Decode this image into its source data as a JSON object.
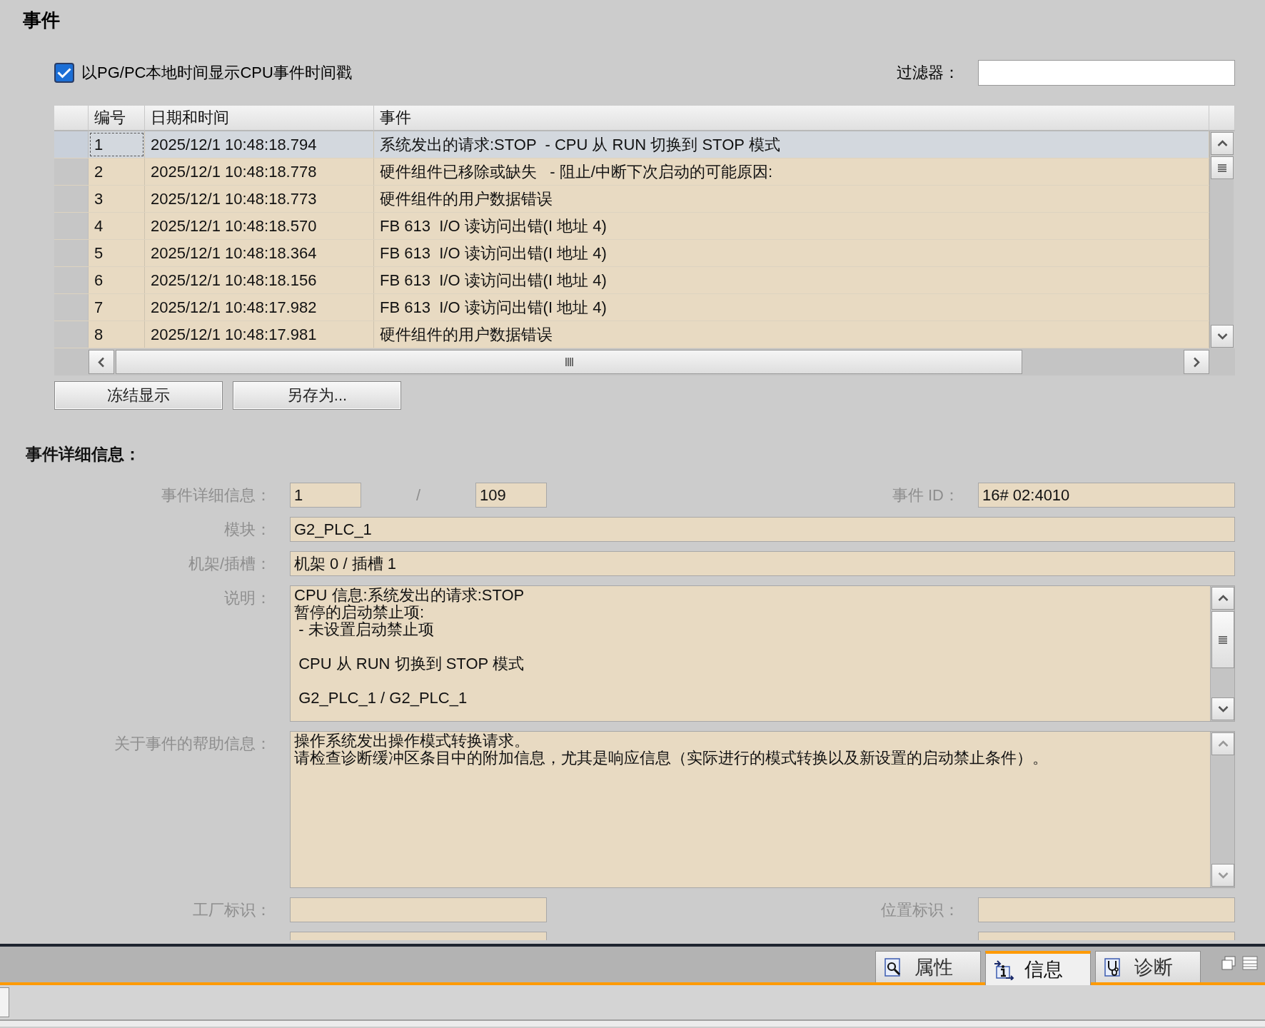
{
  "title": "事件",
  "timestamp_option": {
    "label": "以PG/PC本地时间显示CPU事件时间戳",
    "checked": true
  },
  "filter": {
    "label": "过滤器："
  },
  "table": {
    "columns": [
      "编号",
      "日期和时间",
      "事件"
    ],
    "rows": [
      {
        "number": "1",
        "datetime": "2025/12/1 10:48:18.794",
        "event": "系统发出的请求:STOP  - CPU 从 RUN 切换到 STOP 模式",
        "selected": true
      },
      {
        "number": "2",
        "datetime": "2025/12/1 10:48:18.778",
        "event": "硬件组件已移除或缺失   - 阻止/中断下次启动的可能原因:",
        "selected": false
      },
      {
        "number": "3",
        "datetime": "2025/12/1 10:48:18.773",
        "event": "硬件组件的用户数据错误",
        "selected": false
      },
      {
        "number": "4",
        "datetime": "2025/12/1 10:48:18.570",
        "event": "FB 613  I/O 读访问出错(I 地址 4)",
        "selected": false
      },
      {
        "number": "5",
        "datetime": "2025/12/1 10:48:18.364",
        "event": "FB 613  I/O 读访问出错(I 地址 4)",
        "selected": false
      },
      {
        "number": "6",
        "datetime": "2025/12/1 10:48:18.156",
        "event": "FB 613  I/O 读访问出错(I 地址 4)",
        "selected": false
      },
      {
        "number": "7",
        "datetime": "2025/12/1 10:48:17.982",
        "event": "FB 613  I/O 读访问出错(I 地址 4)",
        "selected": false
      },
      {
        "number": "8",
        "datetime": "2025/12/1 10:48:17.981",
        "event": "硬件组件的用户数据错误",
        "selected": false
      }
    ]
  },
  "buttons": [
    "冻结显示",
    "另存为..."
  ],
  "details": {
    "heading": "事件详细信息：",
    "entry": {
      "label": "事件详细信息：",
      "current": "1",
      "separator": "/",
      "total": "109"
    },
    "event_id": {
      "label": "事件 ID：",
      "value": "16# 02:4010"
    },
    "module": {
      "label": "模块：",
      "value": "G2_PLC_1"
    },
    "rack_slot": {
      "label": "机架/插槽：",
      "value": "机架 0 / 插槽 1"
    },
    "description": {
      "label": "说明：",
      "paragraphs": [
        {
          "lines": [
            "CPU 信息:系统发出的请求:STOP",
            "暂停的启动禁止项:",
            " - 未设置启动禁止项"
          ]
        },
        {
          "lines": [
            " CPU 从 RUN 切换到 STOP 模式"
          ]
        },
        {
          "lines": [
            " G2_PLC_1 / G2_PLC_1"
          ]
        }
      ]
    },
    "help": {
      "label": "关于事件的帮助信息：",
      "lines": [
        "操作系统发出操作模式转换请求。",
        "请检查诊断缓冲区条目中的附加信息，尤其是响应信息（实际进行的模式转换以及新设置的启动禁止条件）。"
      ]
    },
    "plant_id": {
      "label": "工厂标识："
    },
    "location_id": {
      "label": "位置标识："
    }
  },
  "bottom_tabs": [
    {
      "label": "属性",
      "kind": "properties",
      "selected": false
    },
    {
      "label": "信息",
      "kind": "info",
      "selected": true
    },
    {
      "label": "诊断",
      "kind": "diagnostics",
      "selected": false
    }
  ]
}
